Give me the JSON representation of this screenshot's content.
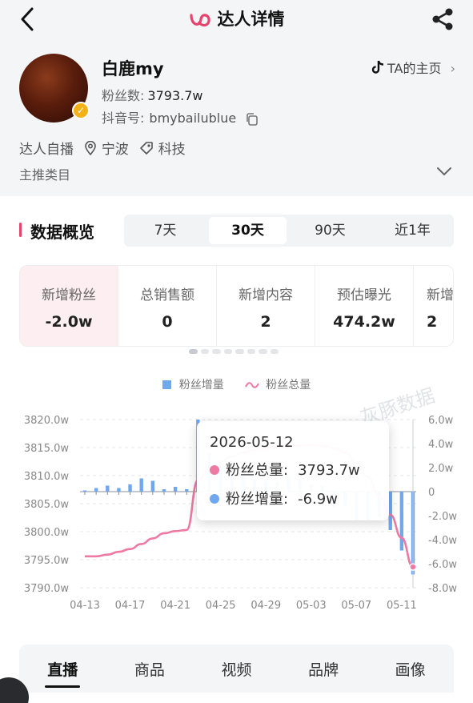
{
  "header": {
    "title": "达人详情",
    "back_icon": "back-arrow-icon",
    "share_icon": "share-icon",
    "brand_color": "#e8436c"
  },
  "profile": {
    "name": "白鹿my",
    "fans_label": "粉丝数:",
    "fans_value": "3793.7w",
    "douyin_label": "抖音号:",
    "douyin_value": "bmybailublue",
    "homepage_label": "TA的主页",
    "tag_type": "达人自播",
    "tag_location": "宁波",
    "tag_category": "科技",
    "category_label": "主推类目"
  },
  "overview": {
    "title": "数据概览",
    "periods": [
      "7天",
      "30天",
      "90天",
      "近1年"
    ],
    "active_period": "30天",
    "metrics": [
      {
        "label": "新增粉丝",
        "value": "-2.0w"
      },
      {
        "label": "总销售额",
        "value": "0"
      },
      {
        "label": "新增内容",
        "value": "2"
      },
      {
        "label": "预估曝光",
        "value": "474.2w"
      },
      {
        "label": "新增",
        "value": "2"
      }
    ]
  },
  "legend": {
    "bar_label": "粉丝增量",
    "line_label": "粉丝总量",
    "bar_color": "#6fa8ef",
    "line_color": "#ee7aa3"
  },
  "watermark": "灰豚数据",
  "chart_data": {
    "type": "bar+line",
    "x_ticks": [
      "04-13",
      "04-17",
      "04-21",
      "04-25",
      "04-29",
      "05-03",
      "05-07",
      "05-11"
    ],
    "y_left_ticks": [
      "3820.0w",
      "3815.0w",
      "3810.0w",
      "3805.0w",
      "3800.0w",
      "3795.0w",
      "3790.0w"
    ],
    "y_right_ticks": [
      "6.0w",
      "4.0w",
      "2.0w",
      "0",
      "-2.0w",
      "-4.0w",
      "-6.0w",
      "-8.0w"
    ],
    "y_left_range": [
      3790,
      3820
    ],
    "y_right_range": [
      -8,
      6
    ],
    "dates": [
      "04-13",
      "04-14",
      "04-15",
      "04-16",
      "04-17",
      "04-18",
      "04-19",
      "04-20",
      "04-21",
      "04-22",
      "04-23",
      "04-24",
      "04-25",
      "04-26",
      "04-27",
      "04-28",
      "04-29",
      "04-30",
      "05-01",
      "05-02",
      "05-03",
      "05-04",
      "05-05",
      "05-06",
      "05-07",
      "05-08",
      "05-09",
      "05-10",
      "05-11",
      "05-12"
    ],
    "series": [
      {
        "name": "粉丝增量",
        "kind": "bar",
        "values": [
          0.1,
          0.3,
          0.5,
          0.3,
          0.6,
          1.1,
          0.9,
          0.2,
          0.4,
          0.2,
          9.0,
          3.2,
          2.4,
          1.6,
          1.4,
          1.1,
          0.9,
          0.8,
          1.3,
          1.0,
          0.6,
          0.5,
          -1.3,
          -1.2,
          -2.4,
          -2.4,
          -2.1,
          -3.2,
          -4.9,
          -6.9
        ]
      },
      {
        "name": "粉丝总量",
        "kind": "line",
        "values": [
          3795.6,
          3795.6,
          3795.9,
          3796.4,
          3796.9,
          3797.8,
          3798.8,
          3799.7,
          3800.1,
          3800.3,
          3809.2,
          3811.2,
          3812.5,
          3813.4,
          3814.1,
          3814.6,
          3814.8,
          3815.0,
          3815.2,
          3815.4,
          3815.5,
          3815.4,
          3814.9,
          3814.1,
          3812.2,
          3809.8,
          3806.2,
          3803.0,
          3798.9,
          3793.7
        ]
      }
    ],
    "tooltip": {
      "date": "2026-05-12",
      "line_label": "粉丝总量:",
      "line_value": "3793.7w",
      "bar_label": "粉丝增量:",
      "bar_value": "-6.9w"
    }
  },
  "bottom_tabs": [
    "直播",
    "商品",
    "视频",
    "品牌",
    "画像"
  ],
  "active_bottom_tab": "直播"
}
